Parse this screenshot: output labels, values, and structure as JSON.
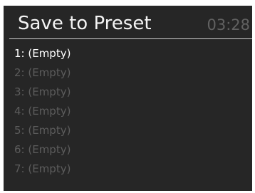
{
  "header": {
    "title": "Save to Preset",
    "time": "03:28"
  },
  "presets": [
    {
      "label": "1: (Empty)",
      "selected": true
    },
    {
      "label": "2: (Empty)",
      "selected": false
    },
    {
      "label": "3: (Empty)",
      "selected": false
    },
    {
      "label": "4: (Empty)",
      "selected": false
    },
    {
      "label": "5: (Empty)",
      "selected": false
    },
    {
      "label": "6: (Empty)",
      "selected": false
    },
    {
      "label": "7: (Empty)",
      "selected": false
    }
  ],
  "colors": {
    "background": "#262626",
    "selected_text": "#ffffff",
    "unselected_text": "#5c5c5c",
    "clock_text": "#616161"
  }
}
